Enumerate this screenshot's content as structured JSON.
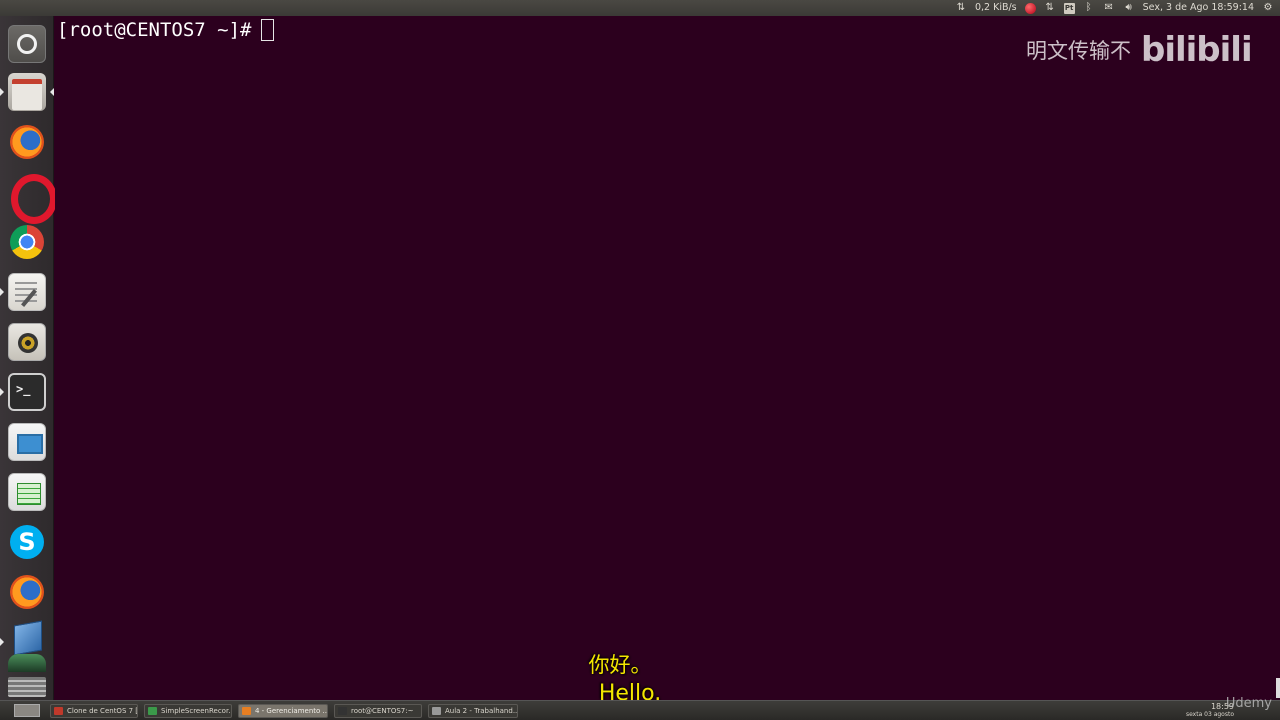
{
  "top_panel": {
    "net_speed": "0,2 KiB/s",
    "datetime": "Sex, 3 de Ago 18:59:14",
    "icons": [
      "transfer-icon",
      "record-icon",
      "network-icon",
      "pt-keyboard-icon",
      "bluetooth-icon",
      "mail-icon",
      "volume-icon",
      "settings-gear-icon"
    ],
    "keyboard_label": "Pt"
  },
  "launcher": {
    "items": [
      "ubuntu-dash",
      "files",
      "firefox",
      "opera",
      "chrome",
      "text-editor",
      "rhythmbox",
      "terminal",
      "libreoffice-impress",
      "libreoffice-calc",
      "skype",
      "firefox",
      "virtualbox"
    ]
  },
  "terminal": {
    "prompt": "[root@CENTOS7 ~]#",
    "background": "#2c001e"
  },
  "watermark": {
    "text": "明文传输不",
    "logo": "bilibili"
  },
  "subtitle": {
    "zh": "你好。",
    "en": "Hello."
  },
  "taskbar": {
    "tasks": [
      {
        "label": "Clone de CentOS 7 [...",
        "active": false
      },
      {
        "label": "SimpleScreenRecor...",
        "active": false
      },
      {
        "label": "4 - Gerenciamento ...",
        "active": true
      },
      {
        "label": "root@CENTOS7:~",
        "active": false
      },
      {
        "label": "Aula 2 - Trabalhand...",
        "active": false
      }
    ],
    "clock_time": "18:59",
    "clock_date": "sexta 03 agosto"
  },
  "brand": "Udemy"
}
